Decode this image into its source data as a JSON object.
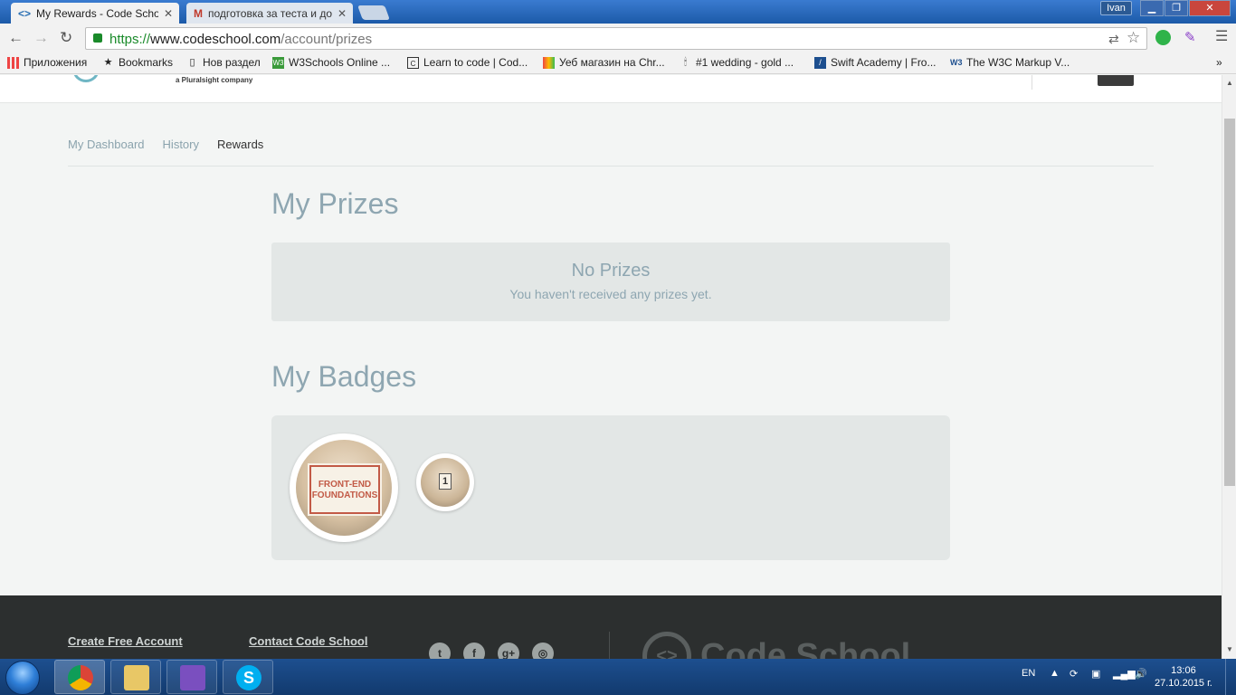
{
  "browser": {
    "tabs": [
      {
        "title": "My Rewards - Code School",
        "active": true
      },
      {
        "title": "подготовка за теста и до",
        "active": false
      }
    ],
    "user_button": "Ivan",
    "url_protocol": "https://",
    "url_host": "www.codeschool.com",
    "url_path": "/account/prizes",
    "bookmarks": [
      {
        "label": "Приложения",
        "icon": "apps-grid-icon"
      },
      {
        "label": "Bookmarks",
        "icon": "star-icon"
      },
      {
        "label": "Нов раздел",
        "icon": "page-icon"
      },
      {
        "label": "W3Schools Online ...",
        "icon": "w3schools-icon"
      },
      {
        "label": "Learn to code | Cod...",
        "icon": "codeschool-icon"
      },
      {
        "label": "Уеб магазин на Chr...",
        "icon": "chrome-store-icon"
      },
      {
        "label": "#1 wedding - gold ...",
        "icon": "wedding-icon"
      },
      {
        "label": "Swift Academy | Fro...",
        "icon": "swift-icon"
      },
      {
        "label": "The W3C Markup V...",
        "icon": "w3c-icon"
      }
    ]
  },
  "site": {
    "logo_tagline": "a Pluralsight company",
    "subnav": [
      {
        "label": "My Dashboard",
        "current": false
      },
      {
        "label": "History",
        "current": false
      },
      {
        "label": "Rewards",
        "current": true
      }
    ],
    "prizes": {
      "title": "My Prizes",
      "empty_title": "No Prizes",
      "empty_text": "You haven't received any prizes yet."
    },
    "badges": {
      "title": "My Badges",
      "items": [
        {
          "name": "FRONT-END FOUNDATIONS"
        },
        {
          "name": "1"
        }
      ]
    },
    "footer": {
      "links": [
        "Create Free Account",
        "Contact Code School"
      ],
      "social": [
        "twitter-icon",
        "facebook-icon",
        "google-plus-icon",
        "instagram-icon"
      ],
      "brand": "Code School"
    }
  },
  "taskbar": {
    "language": "EN",
    "time": "13:06",
    "date": "27.10.2015 г."
  }
}
